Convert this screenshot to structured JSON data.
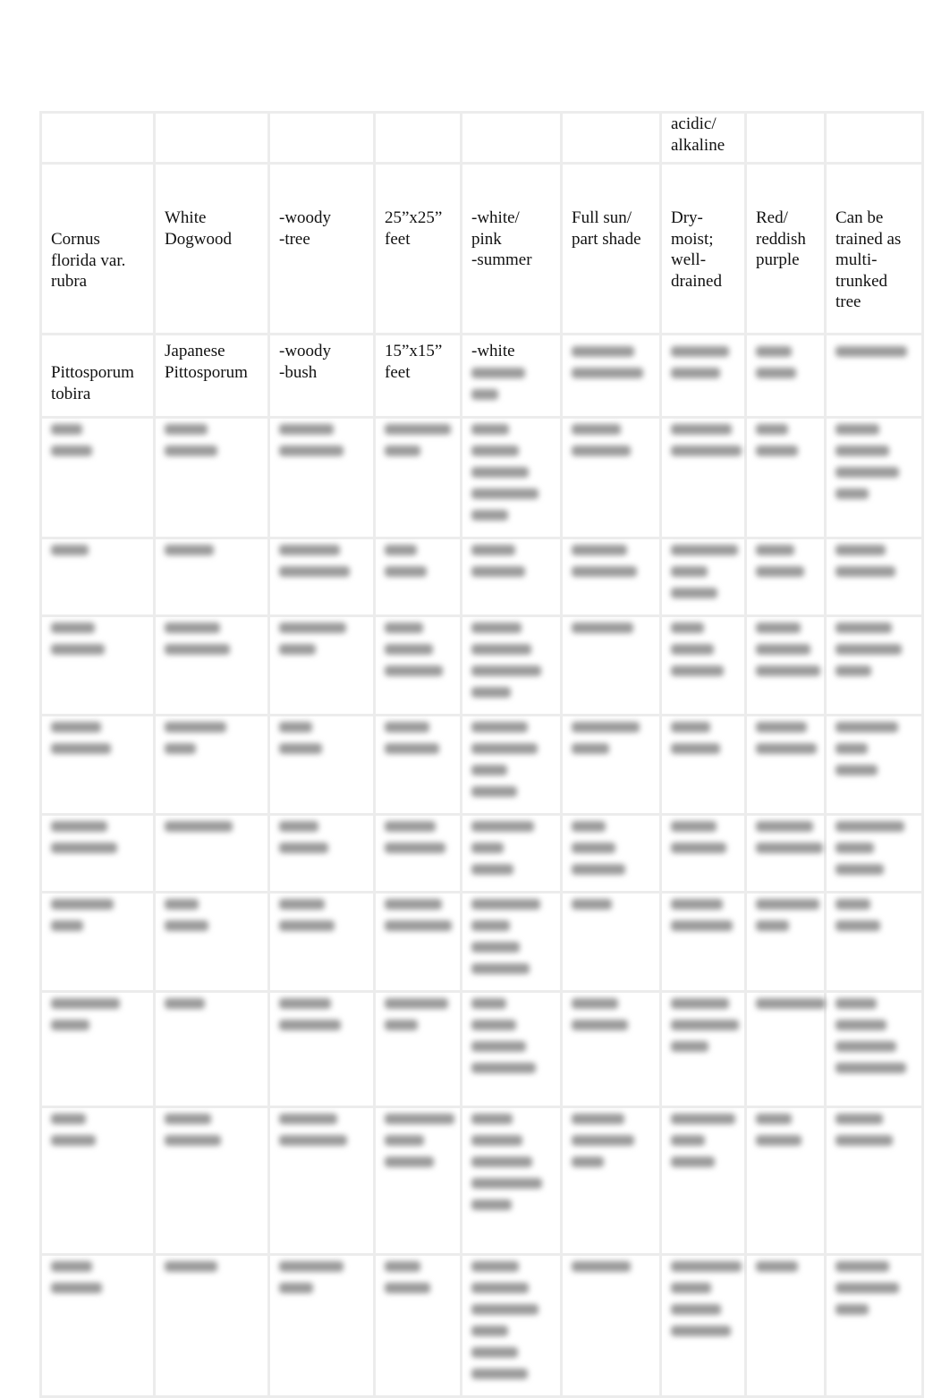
{
  "document": {
    "table": {
      "top_row_overflow_text": "acidic/\nalkaline",
      "rows": [
        {
          "scientific_name": "Cornus\nflorida var.\nrubra",
          "common_name": "White\nDogwood",
          "type": "-woody\n -tree",
          "size": "25”x25”\nfeet",
          "flower": "-white/\npink\n-summer",
          "light": "Full sun/\npart shade",
          "soil": "Dry-\nmoist;\nwell-\ndrained",
          "fall_color": "Red/\nreddish\npurple",
          "notes": "Can be\ntrained as\nmulti-\ntrunked\ntree"
        },
        {
          "scientific_name": "Pittosporum\ntobira",
          "common_name": "Japanese\nPittosporum",
          "type": "-woody\n-bush",
          "size": "15”x15”\nfeet",
          "flower": "-white"
        }
      ],
      "blurred_row_count": 10
    }
  }
}
